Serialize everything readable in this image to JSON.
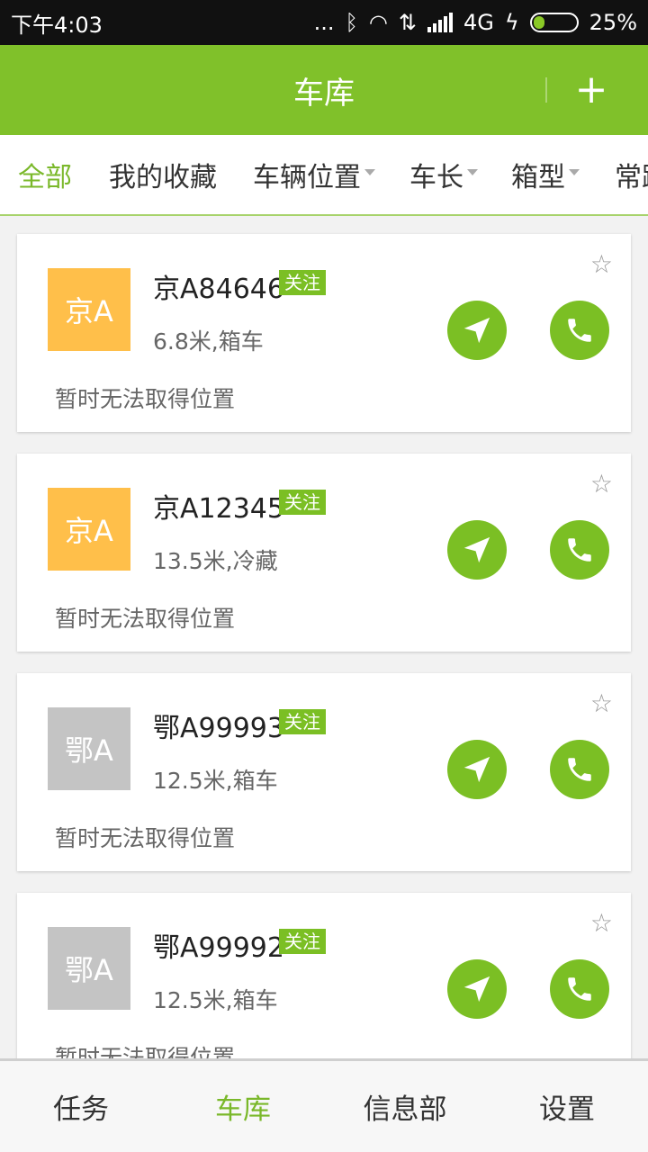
{
  "statusbar": {
    "time": "下午4:03",
    "dots": "...",
    "network": "4G",
    "battery": "25%",
    "battery_level": 0.25
  },
  "header": {
    "title": "车库",
    "add_label": "+"
  },
  "filters": [
    {
      "label": "全部",
      "active": true,
      "dropdown": false
    },
    {
      "label": "我的收藏",
      "active": false,
      "dropdown": false
    },
    {
      "label": "车辆位置",
      "active": false,
      "dropdown": true
    },
    {
      "label": "车长",
      "active": false,
      "dropdown": true
    },
    {
      "label": "箱型",
      "active": false,
      "dropdown": true
    },
    {
      "label": "常跑",
      "active": false,
      "dropdown": false
    }
  ],
  "vehicles": [
    {
      "region": "京A",
      "plate": "京A84646",
      "tag": "关注",
      "spec": "6.8米,箱车",
      "location": "暂时无法取得位置",
      "badge_color": "#ffbf4a"
    },
    {
      "region": "京A",
      "plate": "京A12345",
      "tag": "关注",
      "spec": "13.5米,冷藏",
      "location": "暂时无法取得位置",
      "badge_color": "#ffbf4a"
    },
    {
      "region": "鄂A",
      "plate": "鄂A99993",
      "tag": "关注",
      "spec": "12.5米,箱车",
      "location": "暂时无法取得位置",
      "badge_color": "#c4c4c4"
    },
    {
      "region": "鄂A",
      "plate": "鄂A99992",
      "tag": "关注",
      "spec": "12.5米,箱车",
      "location": "暂时无法取得位置",
      "badge_color": "#c4c4c4"
    }
  ],
  "tabs": [
    {
      "label": "任务",
      "active": false
    },
    {
      "label": "车库",
      "active": true
    },
    {
      "label": "信息部",
      "active": false
    },
    {
      "label": "设置",
      "active": false
    }
  ],
  "colors": {
    "primary": "#80c12a",
    "accent": "#7bbf24"
  }
}
